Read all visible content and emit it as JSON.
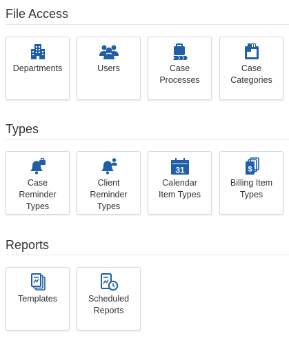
{
  "accent_color": "#1f5fa8",
  "sections": [
    {
      "title": "File Access",
      "tiles": [
        {
          "label": "Departments",
          "icon": "building-icon"
        },
        {
          "label": "Users",
          "icon": "users-icon"
        },
        {
          "label": "Case\nProcesses",
          "icon": "briefcase-process-icon"
        },
        {
          "label": "Case\nCategories",
          "icon": "case-category-icon"
        }
      ]
    },
    {
      "title": "Types",
      "tiles": [
        {
          "label": "Case\nReminder\nTypes",
          "icon": "case-reminder-icon"
        },
        {
          "label": "Client\nReminder\nTypes",
          "icon": "client-reminder-icon"
        },
        {
          "label": "Calendar\nItem Types",
          "icon": "calendar-icon",
          "icon_text": "31"
        },
        {
          "label": "Billing Item\nTypes",
          "icon": "billing-icon",
          "icon_text": "$"
        }
      ]
    },
    {
      "title": "Reports",
      "tiles": [
        {
          "label": "Templates",
          "icon": "templates-icon"
        },
        {
          "label": "Scheduled\nReports",
          "icon": "scheduled-report-icon"
        }
      ]
    }
  ]
}
